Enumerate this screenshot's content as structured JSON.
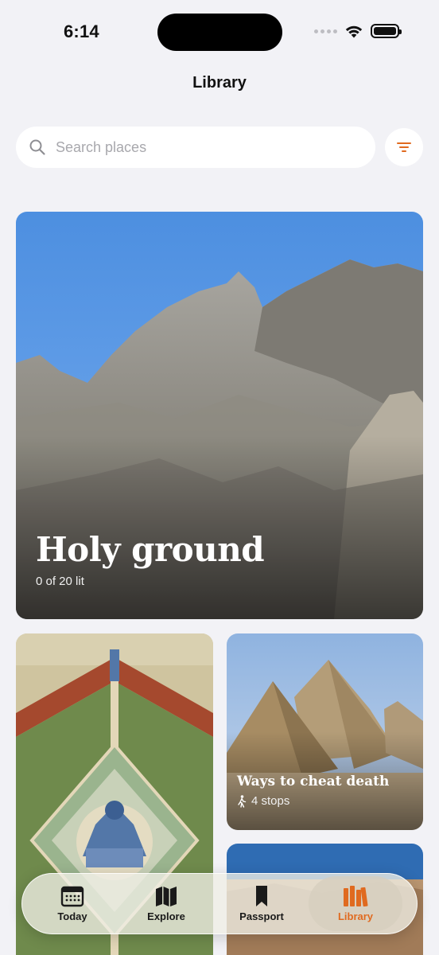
{
  "status": {
    "time": "6:14"
  },
  "header": {
    "title": "Library"
  },
  "search": {
    "placeholder": "Search places",
    "value": ""
  },
  "filter": {
    "icon": "filter-icon",
    "color": "#e06a1f"
  },
  "collections": [
    {
      "title": "Holy ground",
      "subtitle": "0 of 20 lit"
    },
    {
      "title": "",
      "image": "historic-map-engraving"
    },
    {
      "title": "Ways to cheat death",
      "subtitle": "4 stops",
      "icon": "walking-person-icon"
    },
    {
      "title": "",
      "image": "desert-landscape"
    }
  ],
  "tabs": [
    {
      "label": "Today",
      "icon": "calendar-icon",
      "active": false
    },
    {
      "label": "Explore",
      "icon": "map-icon",
      "active": false
    },
    {
      "label": "Passport",
      "icon": "bookmark-icon",
      "active": false
    },
    {
      "label": "Library",
      "icon": "books-icon",
      "active": true
    }
  ],
  "colors": {
    "accent": "#e06a1f",
    "background": "#f2f2f6"
  }
}
